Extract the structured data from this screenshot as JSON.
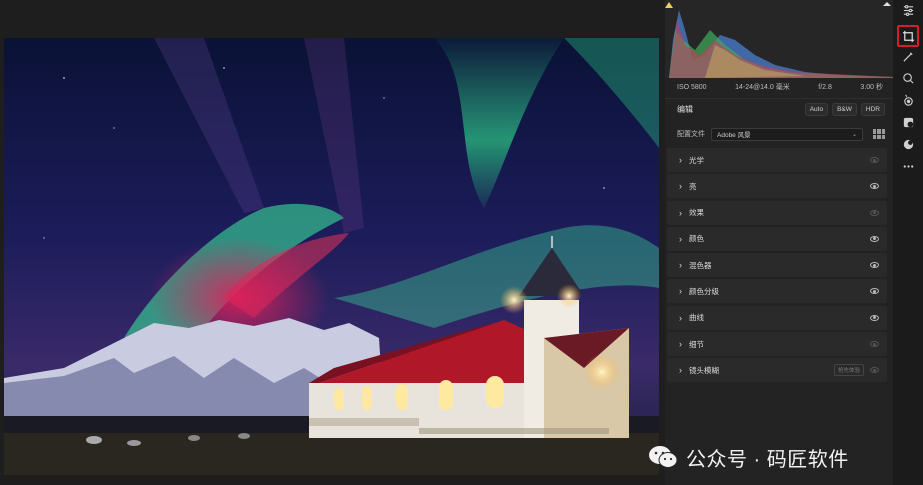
{
  "exif": {
    "iso": "ISO 5800",
    "lens": "14-24@14.0 毫米",
    "aperture": "f/2.8",
    "shutter": "3.00 秒"
  },
  "edit": {
    "title": "编辑",
    "auto": "Auto",
    "bw": "B&W",
    "hdr": "HDR"
  },
  "profile": {
    "label": "配置文件",
    "value": "Adobe 风景"
  },
  "sections": [
    {
      "label": "光学",
      "visible": false
    },
    {
      "label": "亮",
      "visible": true
    },
    {
      "label": "效果",
      "visible": false
    },
    {
      "label": "颜色",
      "visible": true
    },
    {
      "label": "混色器",
      "visible": true
    },
    {
      "label": "颜色分级",
      "visible": true
    },
    {
      "label": "曲线",
      "visible": true
    },
    {
      "label": "细节",
      "visible": false
    },
    {
      "label": "镜头模糊",
      "tag": "抢先体验",
      "visible": false
    }
  ],
  "watermark": "公众号 · 码匠软件",
  "colors": {
    "accent_red": "#d0202a",
    "panel_bg": "#232323",
    "section_bg": "#2a2a2a"
  },
  "tools": [
    "edit-sliders-icon",
    "crop-icon",
    "brush-icon",
    "heal-icon",
    "mask-icon",
    "red-eye-icon",
    "presets-icon",
    "snapshots-icon",
    "more-icon"
  ]
}
